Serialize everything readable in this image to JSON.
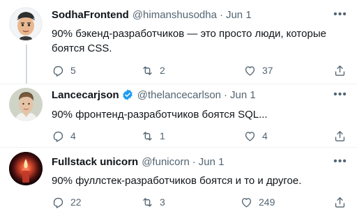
{
  "colors": {
    "text": "#0f1419",
    "secondary": "#536471",
    "verified": "#1d9bf0",
    "divider": "#eff3f4",
    "thread_line": "#cfd9de"
  },
  "tweets": [
    {
      "name": "SodhaFrontend",
      "handle": "@himanshusodha",
      "separator": "·",
      "date": "Jun 1",
      "text_lines": [
        "90% бэкенд-разработчиков — это просто люди, которые",
        "боятся CSS."
      ],
      "replies": "5",
      "retweets": "2",
      "likes": "37",
      "verified": false,
      "avatar": "cartoon-man-avatar"
    },
    {
      "name": "Lancecarjson",
      "handle": "@thelancecarlson",
      "separator": "·",
      "date": "Jun 1",
      "text_lines": [
        "90% фронтенд-разработчиков боятся SQL..."
      ],
      "replies": "4",
      "retweets": "1",
      "likes": "4",
      "verified": true,
      "avatar": "photo-man-avatar"
    },
    {
      "name": "Fullstack unicorn",
      "handle": "@funicorn",
      "separator": "·",
      "date": "Jun 1",
      "text_lines": [
        "90% фуллстек-разработчиков боятся и то и другое."
      ],
      "replies": "22",
      "retweets": "3",
      "likes": "249",
      "verified": false,
      "avatar": "candle-avatar"
    }
  ],
  "icons": {
    "more": "more-icon",
    "reply": "reply-icon",
    "retweet": "retweet-icon",
    "like": "like-icon",
    "share": "share-icon",
    "verified": "verified-icon"
  }
}
